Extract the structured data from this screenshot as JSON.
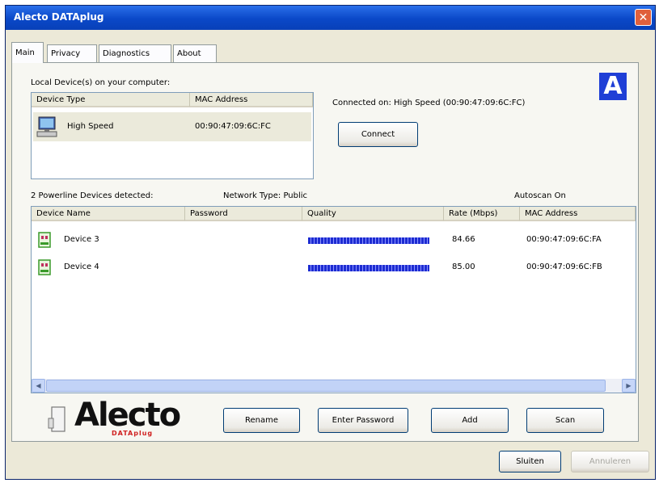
{
  "window": {
    "title": "Alecto DATAplug",
    "close_glyph": "✕"
  },
  "tabs": [
    {
      "label": "Main"
    },
    {
      "label": "Privacy"
    },
    {
      "label": "Diagnostics"
    },
    {
      "label": "About"
    }
  ],
  "local": {
    "section_label": "Local Device(s) on your computer:",
    "columns": [
      "Device Type",
      "MAC Address"
    ],
    "rows": [
      {
        "type": "High Speed",
        "mac": "00:90:47:09:6C:FC"
      }
    ],
    "connected_text": "Connected on: High Speed (00:90:47:09:6C:FC)",
    "connect_button": "Connect"
  },
  "powerline": {
    "detected_label": "2 Powerline Devices detected:",
    "network_type": "Network Type: Public",
    "autoscan": "Autoscan On",
    "columns": [
      "Device Name",
      "Password",
      "Quality",
      "Rate (Mbps)",
      "MAC Address"
    ],
    "rows": [
      {
        "name": "Device 3",
        "password": "",
        "quality": 0.95,
        "rate": "84.66",
        "mac": "00:90:47:09:6C:FA"
      },
      {
        "name": "Device 4",
        "password": "",
        "quality": 0.95,
        "rate": "85.00",
        "mac": "00:90:47:09:6C:FB"
      }
    ]
  },
  "brand": {
    "name": "Alecto",
    "sub": "DATAplug",
    "mark": "A"
  },
  "buttons": {
    "rename": "Rename",
    "enter_password": "Enter Password",
    "add": "Add",
    "scan": "Scan",
    "close": "Sluiten",
    "apply": "Annuleren"
  },
  "icons": {
    "computer": "computer-icon",
    "powerline_device": "powerline-device-icon",
    "plug": "plug-icon",
    "logo": "alecto-logo-icon"
  },
  "colors": {
    "title_bar": "#0a48c8",
    "quality_bar": "#1d2cd2",
    "logo_blue": "#1f3fd6",
    "brand_red": "#d02020"
  }
}
